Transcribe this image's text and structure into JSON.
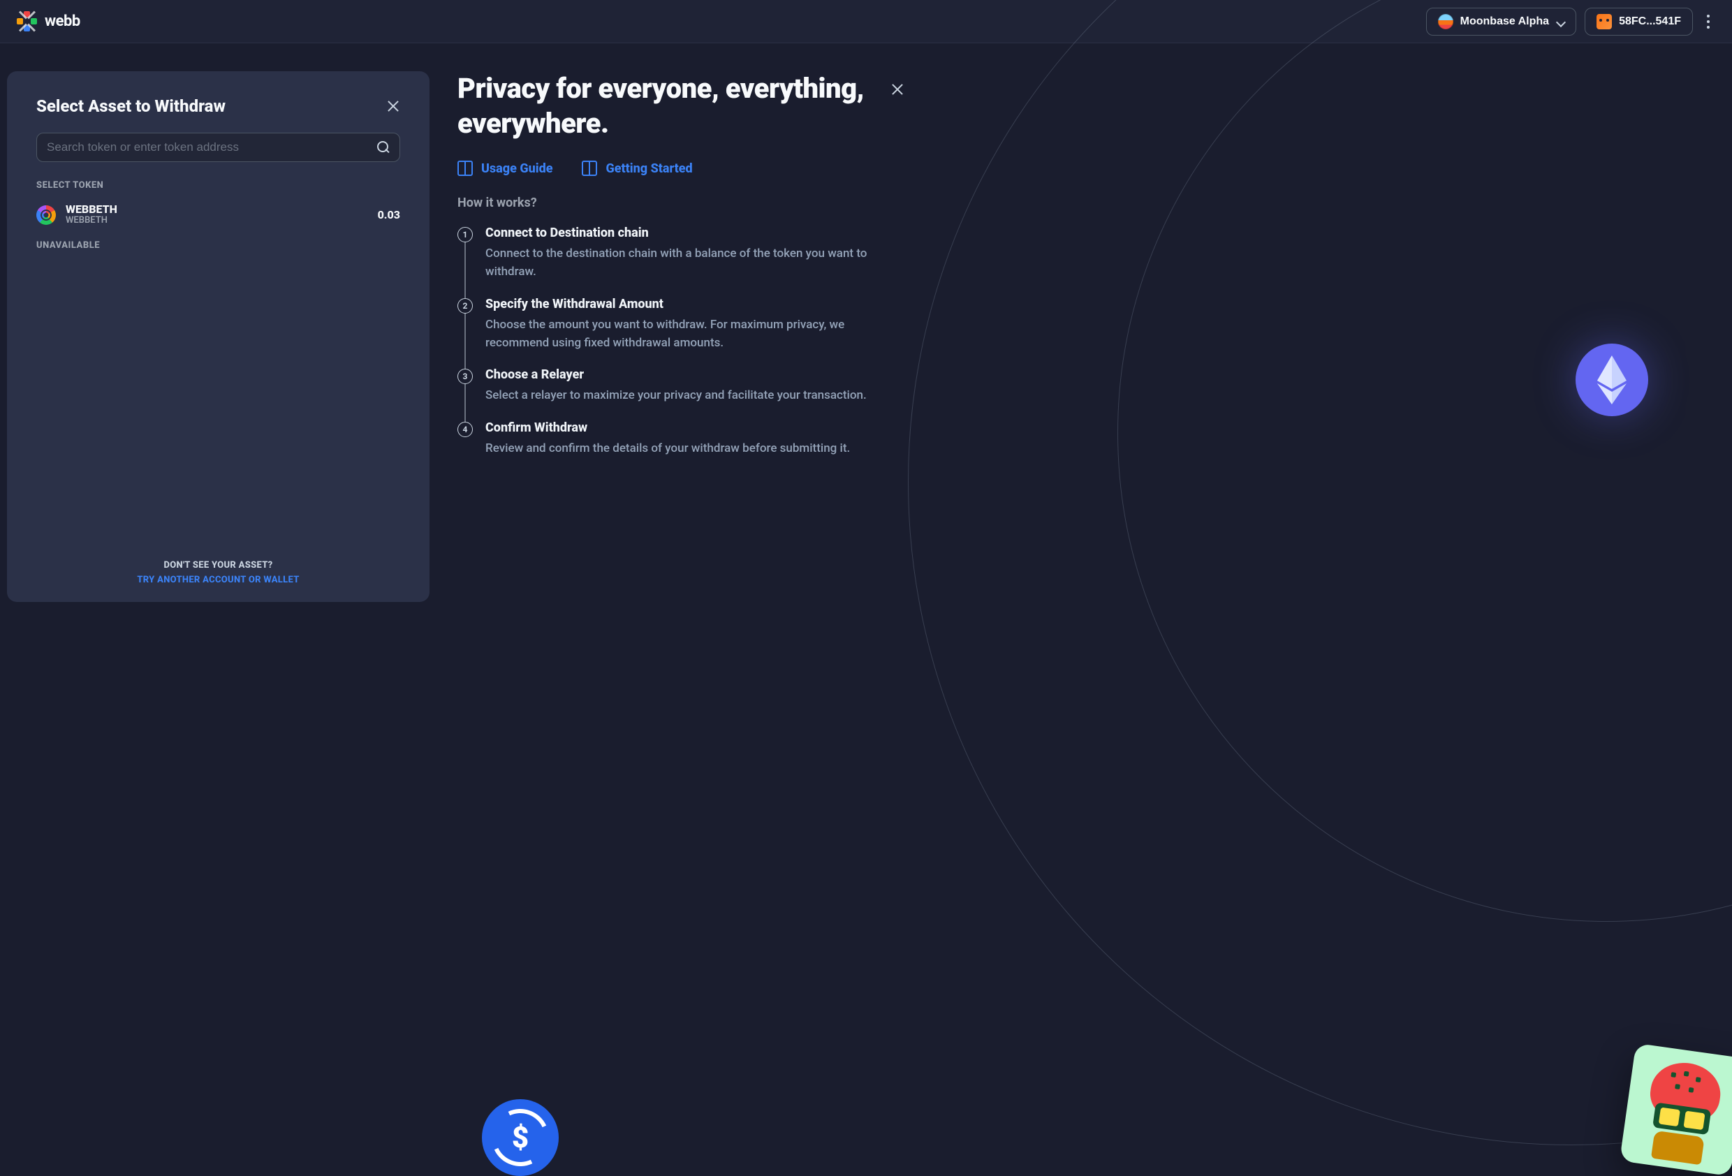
{
  "brand": {
    "name": "webb"
  },
  "header": {
    "network_label": "Moonbase Alpha",
    "account_label": "58FC...541F"
  },
  "panel": {
    "title": "Select Asset to Withdraw",
    "search_placeholder": "Search token or enter token address",
    "section_select": "SELECT TOKEN",
    "section_unavailable": "UNAVAILABLE",
    "tokens": [
      {
        "name": "WEBBETH",
        "symbol": "WEBBETH",
        "balance": "0.03"
      }
    ],
    "footer_question": "DON'T SEE YOUR ASSET?",
    "footer_link": "TRY ANOTHER ACCOUNT OR WALLET"
  },
  "hero": {
    "title": "Privacy for everyone, everything, everywhere.",
    "links": {
      "usage_guide": "Usage Guide",
      "getting_started": "Getting Started"
    },
    "how_label": "How it works?",
    "steps": [
      {
        "num": "1",
        "title": "Connect to Destination chain",
        "desc": "Connect to the destination chain with a balance of the token you want to withdraw."
      },
      {
        "num": "2",
        "title": "Specify the Withdrawal Amount",
        "desc": "Choose the amount you want to withdraw. For maximum privacy, we recommend using fixed withdrawal amounts."
      },
      {
        "num": "3",
        "title": "Choose a Relayer",
        "desc": "Select a relayer to maximize your privacy and facilitate your transaction."
      },
      {
        "num": "4",
        "title": "Confirm Withdraw",
        "desc": "Review and confirm the details of your withdraw before submitting it."
      }
    ]
  }
}
